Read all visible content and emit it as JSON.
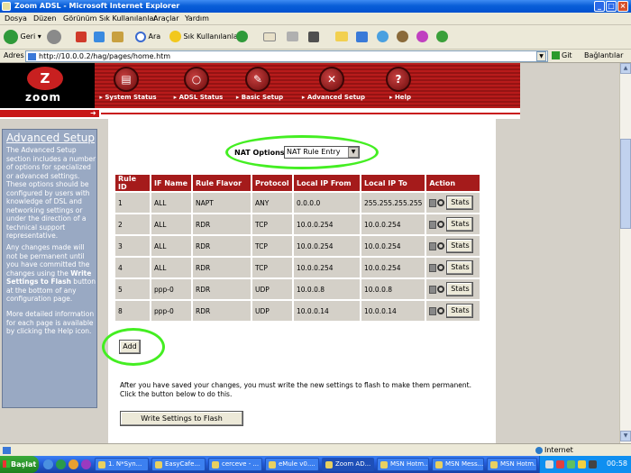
{
  "window": {
    "title": "Zoom ADSL - Microsoft Internet Explorer",
    "controls": [
      "_",
      "□",
      "×"
    ]
  },
  "menu": [
    "Dosya",
    "Düzen",
    "Görünüm",
    "Sık Kullanılanlar",
    "Araçlar",
    "Yardım"
  ],
  "toolbar": {
    "back_label": "Geri",
    "search_label": "Ara",
    "favorites_label": "Sık Kullanılanlar"
  },
  "address": {
    "label": "Adres",
    "url": "http://10.0.0.2/hag/pages/home.htm",
    "go_label": "Git",
    "links_label": "Bağlantılar"
  },
  "banner": {
    "logo_text": "zoom",
    "nav": [
      {
        "label": "System Status",
        "icon": "status-icon"
      },
      {
        "label": "ADSL Status",
        "icon": "magnifier-icon"
      },
      {
        "label": "Basic Setup",
        "icon": "basic-setup-icon"
      },
      {
        "label": "Advanced Setup",
        "icon": "wrench-icon"
      },
      {
        "label": "Help",
        "icon": "help-icon"
      }
    ]
  },
  "side": {
    "title": "Advanced Setup",
    "p1": "The Advanced Setup section includes a number of options for specialized or advanced settings. These options should be configured by users with knowledge of DSL and networking settings or under the direction of a technical support representative.",
    "p2_pre": "Any changes made will not be permanent until you have committed the changes using the ",
    "p2_bold": "Write Settings to Flash",
    "p2_post": " button at the bottom of any configuration page.",
    "p3": "More detailed information for each page is available by clicking the Help icon."
  },
  "nat": {
    "label": "NAT Options:",
    "selected": "NAT Rule Entry"
  },
  "table": {
    "headers": [
      "Rule ID",
      "IF Name",
      "Rule Flavor",
      "Protocol",
      "Local IP From",
      "Local IP To",
      "Action"
    ],
    "rows": [
      {
        "id": "1",
        "ifname": "ALL",
        "flavor": "NAPT",
        "protocol": "ANY",
        "from": "0.0.0.0",
        "to": "255.255.255.255"
      },
      {
        "id": "2",
        "ifname": "ALL",
        "flavor": "RDR",
        "protocol": "TCP",
        "from": "10.0.0.254",
        "to": "10.0.0.254"
      },
      {
        "id": "3",
        "ifname": "ALL",
        "flavor": "RDR",
        "protocol": "TCP",
        "from": "10.0.0.254",
        "to": "10.0.0.254"
      },
      {
        "id": "4",
        "ifname": "ALL",
        "flavor": "RDR",
        "protocol": "TCP",
        "from": "10.0.0.254",
        "to": "10.0.0.254"
      },
      {
        "id": "5",
        "ifname": "ppp-0",
        "flavor": "RDR",
        "protocol": "UDP",
        "from": "10.0.0.8",
        "to": "10.0.0.8"
      },
      {
        "id": "8",
        "ifname": "ppp-0",
        "flavor": "RDR",
        "protocol": "UDP",
        "from": "10.0.0.14",
        "to": "10.0.0.14"
      }
    ],
    "stats_label": "Stats"
  },
  "add_label": "Add",
  "message": "After you have saved your changes, you must write the new settings to flash to make them permanent. Click the button below to do this.",
  "write_label": "Write Settings to Flash",
  "status": {
    "zone": "Internet"
  },
  "taskbar": {
    "start": "Başlat",
    "tabs": [
      "1. N*Syn...",
      "EasyCafe...",
      "cerceve - ...",
      "eMule v0....",
      "Zoom AD...",
      "MSN Hotm...",
      "MSN Mess...",
      "MSN Hotm..."
    ],
    "clock": "00:58"
  }
}
